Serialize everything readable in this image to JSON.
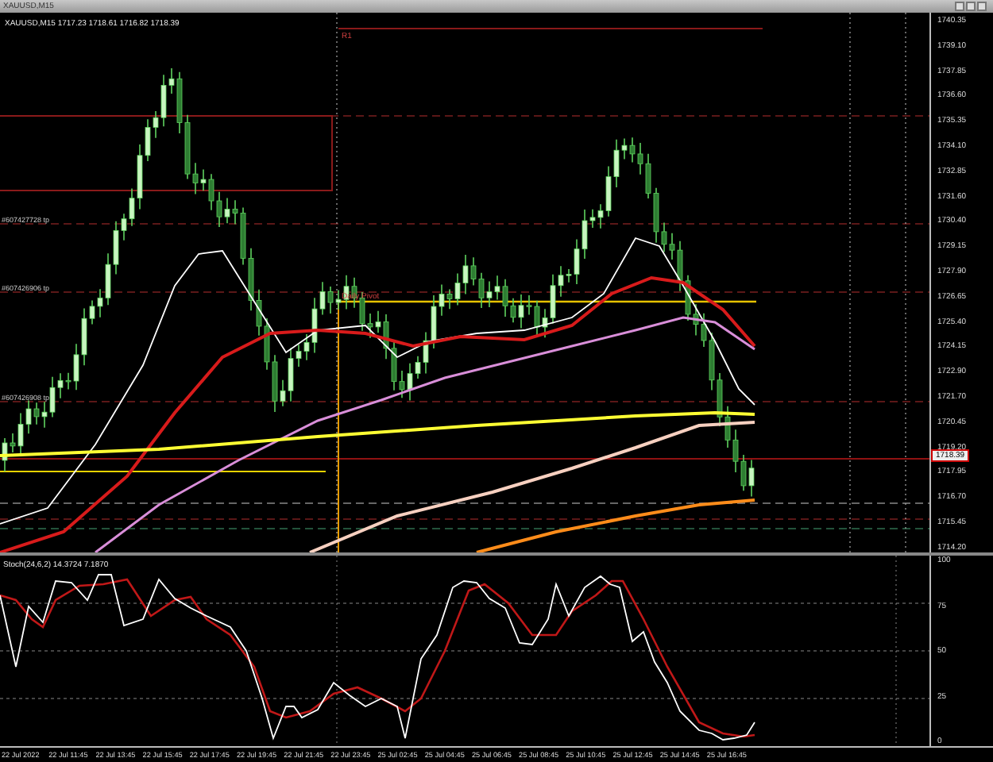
{
  "window": {
    "title": "XAUUSD,M15"
  },
  "chart": {
    "symbol_info": "XAUUSD,M15  1717.23 1718.61 1716.82 1718.39",
    "price_labels": [
      "1740.35",
      "1739.10",
      "1737.85",
      "1736.60",
      "1735.35",
      "1734.10",
      "1732.85",
      "1731.60",
      "1730.40",
      "1729.15",
      "1727.90",
      "1726.65",
      "1725.40",
      "1724.15",
      "1722.90",
      "1721.70",
      "1720.45",
      "1719.20",
      "1717.95",
      "1716.70",
      "1715.45",
      "1714.20"
    ],
    "current_price": "1718.39",
    "order_labels": [
      "#607427728 tp",
      "#607426906 tp",
      "#607426908 tp"
    ],
    "level_labels": [
      "R1",
      "Daily Pivot"
    ]
  },
  "oscillator": {
    "title": "Stoch(24,6,2) 14.3724 7.1870",
    "scale_labels": [
      "100",
      "75",
      "50",
      "25",
      "0"
    ]
  },
  "time_axis": {
    "labels": [
      "22 Jul 2022",
      "22 Jul 11:45",
      "22 Jul 13:45",
      "22 Jul 15:45",
      "22 Jul 17:45",
      "22 Jul 19:45",
      "22 Jul 21:45",
      "22 Jul 23:45",
      "25 Jul 02:45",
      "25 Jul 04:45",
      "25 Jul 06:45",
      "25 Jul 08:45",
      "25 Jul 10:45",
      "25 Jul 12:45",
      "25 Jul 14:45",
      "25 Jul 16:45"
    ]
  }
}
